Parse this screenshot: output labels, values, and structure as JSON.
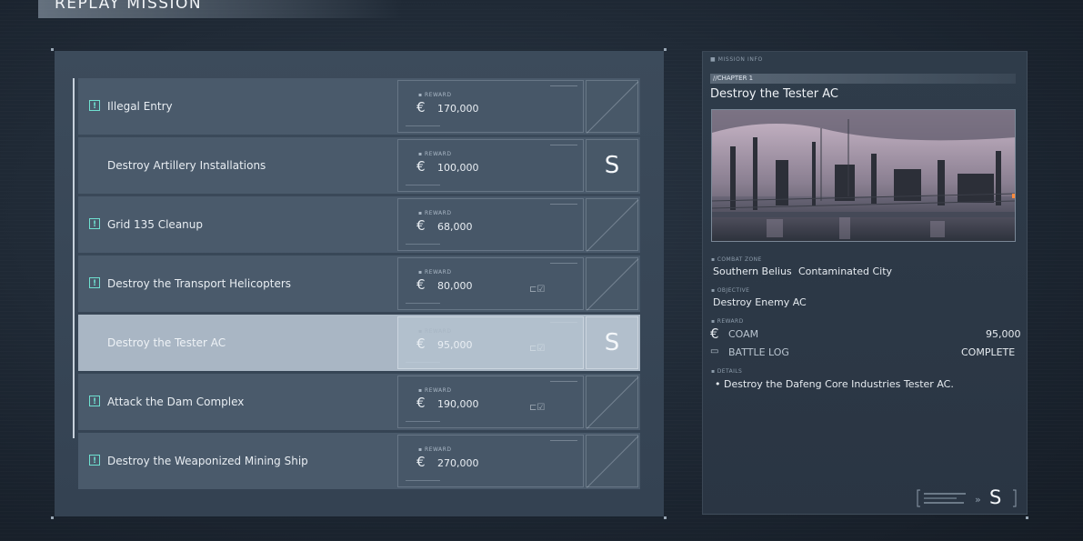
{
  "header": {
    "title": "REPLAY MISSION"
  },
  "missions": [
    {
      "name": "Illegal Entry",
      "alert": true,
      "reward_label": "REWARD",
      "currency_icon": "€",
      "reward": "170,000",
      "battle_log": "",
      "rank": "",
      "selected": false
    },
    {
      "name": "Destroy Artillery Installations",
      "alert": false,
      "reward_label": "REWARD",
      "currency_icon": "€",
      "reward": "100,000",
      "battle_log": "",
      "rank": "S",
      "selected": false
    },
    {
      "name": "Grid 135 Cleanup",
      "alert": true,
      "reward_label": "REWARD",
      "currency_icon": "€",
      "reward": "68,000",
      "battle_log": "",
      "rank": "",
      "selected": false
    },
    {
      "name": "Destroy the Transport Helicopters",
      "alert": true,
      "reward_label": "REWARD",
      "currency_icon": "€",
      "reward": "80,000",
      "battle_log": "battle-log-icon",
      "rank": "",
      "selected": false
    },
    {
      "name": "Destroy the Tester AC",
      "alert": false,
      "reward_label": "REWARD",
      "currency_icon": "€",
      "reward": "95,000",
      "battle_log": "battle-log-icon",
      "rank": "S",
      "selected": true
    },
    {
      "name": "Attack the Dam Complex",
      "alert": true,
      "reward_label": "REWARD",
      "currency_icon": "€",
      "reward": "190,000",
      "battle_log": "battle-log-icon",
      "rank": "",
      "selected": false
    },
    {
      "name": "Destroy the Weaponized Mining Ship",
      "alert": true,
      "reward_label": "REWARD",
      "currency_icon": "€",
      "reward": "270,000",
      "battle_log": "",
      "rank": "",
      "selected": false
    }
  ],
  "info": {
    "section_label": "MISSION INFO",
    "chapter": "//CHAPTER 1",
    "title": "Destroy the Tester AC",
    "combat_zone_label": "COMBAT ZONE",
    "combat_zone_region": "Southern Belius",
    "combat_zone_area": "Contaminated City",
    "objective_label": "OBJECTIVE",
    "objective": "Destroy Enemy AC",
    "reward_label": "REWARD",
    "coam_label": "COAM",
    "coam_value": "95,000",
    "battle_log_label": "BATTLE LOG",
    "battle_log_value": "COMPLETE",
    "details_label": "DETAILS",
    "details": "• Destroy the Dafeng Core Industries Tester AC.",
    "rank": "S"
  },
  "colors": {
    "accent_alert": "#6fe0d0",
    "selected_row": "#a9b6c4",
    "row": "#4a5a6b"
  }
}
